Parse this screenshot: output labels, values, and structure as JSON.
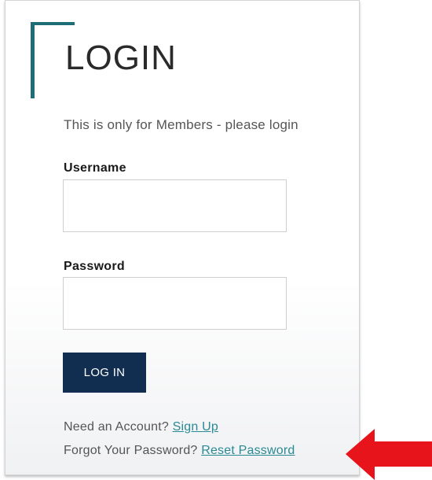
{
  "login": {
    "title": "LOGIN",
    "subtitle": "This is only for Members - please login",
    "username_label": "Username",
    "username_value": "",
    "password_label": "Password",
    "password_value": "",
    "login_button": "LOG IN",
    "signup_prompt": "Need an Account?",
    "signup_link": "Sign Up",
    "reset_prompt": "Forgot Your Password?",
    "reset_link": "Reset Password"
  },
  "colors": {
    "accent": "#1d6e77",
    "button": "#112e51",
    "link": "#2a8a94",
    "annotation_arrow": "#e8141b"
  },
  "annotation": {
    "icon": "red-arrow-icon"
  }
}
